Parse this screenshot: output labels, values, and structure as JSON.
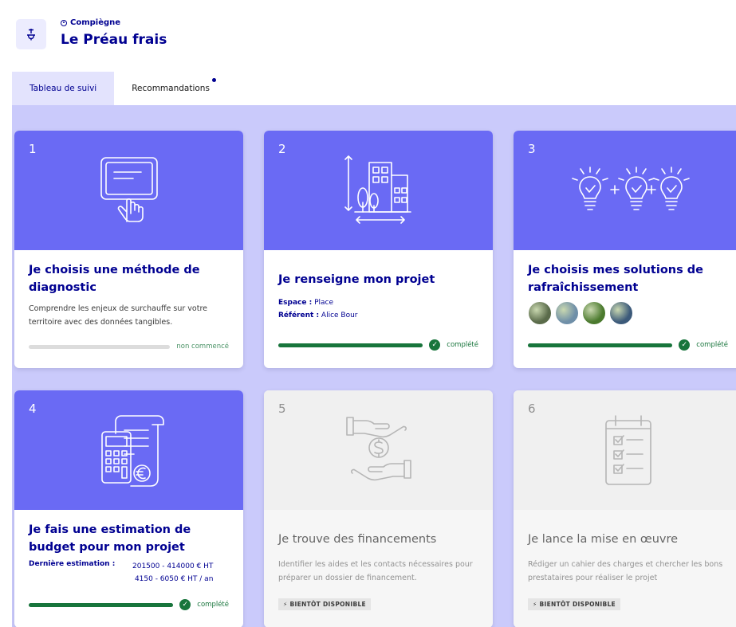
{
  "header": {
    "location": "Compiègne",
    "title": "Le Préau frais"
  },
  "tabs": [
    {
      "label": "Tableau de suivi",
      "active": true
    },
    {
      "label": "Recommandations",
      "notification": true
    }
  ],
  "cards": [
    {
      "number": "1",
      "icon": "touchscreen-hand-icon",
      "title": "Je choisis une méthode de diagnostic",
      "description": "Comprendre les enjeux de surchauffe sur votre territoire avec des données tangibles.",
      "progress": 0,
      "status": "non commencé"
    },
    {
      "number": "2",
      "icon": "buildings-tree-icon",
      "title": "Je renseigne mon projet",
      "info": [
        {
          "label": "Espace :",
          "value": "Place"
        },
        {
          "label": "Référent :",
          "value": "Alice Bour"
        }
      ],
      "progress": 100,
      "status": "complété"
    },
    {
      "number": "3",
      "icon": "lightbulbs-icon",
      "title": "Je choisis mes solutions de rafraîchissement",
      "avatar_colors": [
        "#5a6b4a",
        "#6f8fa8",
        "#4b7a2e",
        "#3c5a7a"
      ],
      "progress": 100,
      "status": "complété"
    },
    {
      "number": "4",
      "icon": "calculator-receipt-icon",
      "title": "Je fais une estimation de budget pour mon projet",
      "estimate_label": "Dernière estimation :",
      "estimate_values": [
        "201500 - 414000 € HT",
        "4150 - 6050 € HT / an"
      ],
      "progress": 100,
      "status": "complété"
    },
    {
      "number": "5",
      "icon": "hands-money-icon",
      "title": "Je trouve des financements",
      "description": "Identifier les aides et les contacts nécessaires pour préparer un dossier de financement.",
      "badge": "⚡ BIENTÔT DISPONIBLE"
    },
    {
      "number": "6",
      "icon": "checklist-clipboard-icon",
      "title": "Je lance la mise en œuvre",
      "description": "Rédiger un cahier des charges et chercher les bons prestataires pour réaliser le projet",
      "badge": "⚡ BIENTÔT DISPONIBLE"
    }
  ],
  "colors": {
    "primary": "#000091",
    "card_header": "#6a6af4",
    "board_bg": "#cacafb",
    "success": "#18753c"
  }
}
